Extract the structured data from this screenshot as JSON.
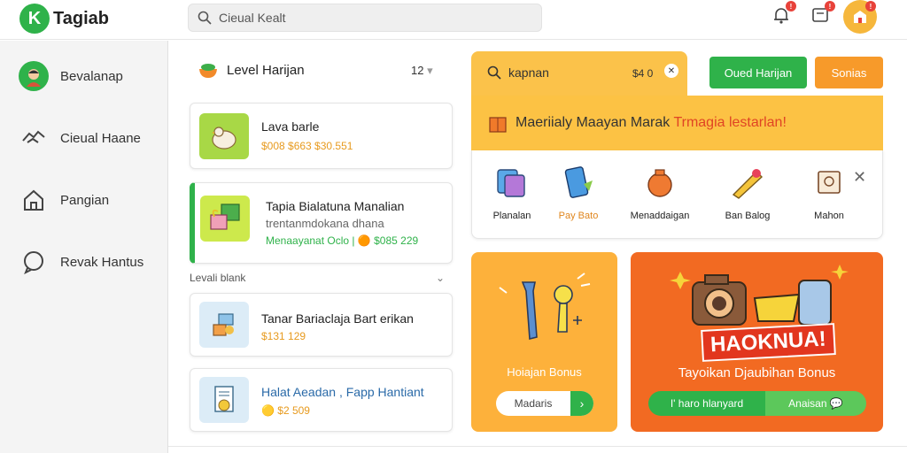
{
  "app": {
    "logo_text": "Tagiab",
    "logo_letter": "K"
  },
  "search": {
    "placeholder": "Cieual Kealt"
  },
  "header": {
    "notif1_badge": "!",
    "notif2_badge": "!",
    "avatar_badge": "!"
  },
  "sidebar": {
    "items": [
      {
        "label": "Bevalanap",
        "icon": "user-avatar-icon"
      },
      {
        "label": "Cieual Haane",
        "icon": "handshake-icon"
      },
      {
        "label": "Pangian",
        "icon": "home-icon"
      },
      {
        "label": "Revak Hantus",
        "icon": "chat-icon"
      }
    ]
  },
  "middle": {
    "title": "Level Harijan",
    "count": "12",
    "section_label": "Levali blank",
    "cards": [
      {
        "title": "Lava barle",
        "subtitle": "",
        "price": "$008 $663 $30.551",
        "icon": "chicken-icon"
      },
      {
        "title": "Tapia Bialatuna Manalian",
        "subtitle": "trentanmdokana dhana",
        "price": "Menaayanat Oclo | 🟠 $085 229",
        "icon": "gift-boxes-icon"
      },
      {
        "title": "Tanar Bariaclaja Bart erikan",
        "subtitle": "",
        "price": "$131 129",
        "icon": "box-icon"
      },
      {
        "title": "Halat Aeadan , Fapp Hantiant",
        "subtitle": "",
        "price": "🟡 $2 509",
        "icon": "document-icon"
      }
    ]
  },
  "right": {
    "head_label": "kapnan",
    "head_count": "$4 0",
    "btn_green": "Oued Harijan",
    "btn_orange": "Sonias",
    "banner_text": "Maeriialy Maayan Marak ",
    "banner_highlight": "Trmagia lestarlan!",
    "categories": [
      {
        "label": "Planalan",
        "icon": "cards-icon"
      },
      {
        "label": "Pay Bato",
        "icon": "phone-icon"
      },
      {
        "label": "Menaddaigan",
        "icon": "pot-icon"
      },
      {
        "label": "Ban Balog",
        "icon": "food-icon"
      },
      {
        "label": "Mahon",
        "icon": "frame-icon"
      }
    ],
    "promo1": {
      "title": "Hoiajan Bonus",
      "button": "Madaris"
    },
    "promo2": {
      "headline": "HAOKNUA!",
      "title": "Tayoikan Djaubihan Bonus",
      "button_a": "I' haro hlanyard",
      "button_b": "Anaisan"
    }
  },
  "colors": {
    "green": "#2fb24a",
    "orange": "#f79a2a",
    "yellow": "#fcc244",
    "red": "#e04424"
  }
}
